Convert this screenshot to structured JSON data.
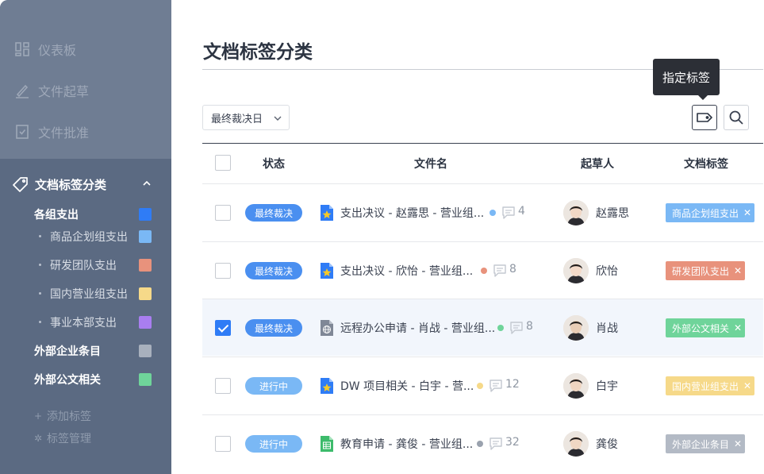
{
  "sidebar": {
    "nav": [
      {
        "label": "仪表板",
        "icon": "dashboard-icon"
      },
      {
        "label": "文件起草",
        "icon": "pen-icon"
      },
      {
        "label": "文件批准",
        "icon": "checkdoc-icon"
      }
    ],
    "section": {
      "label": "文档标签分类",
      "icon": "tag-icon"
    },
    "tags": [
      {
        "label": "各组支出",
        "level": "parent",
        "color": "#2f7cf6"
      },
      {
        "label": "商品企划组支出",
        "level": "child",
        "color": "#7ab8f5"
      },
      {
        "label": "研发团队支出",
        "level": "child",
        "color": "#e8927c"
      },
      {
        "label": "国内营业组支出",
        "level": "child",
        "color": "#f6d989"
      },
      {
        "label": "事业本部支出",
        "level": "child",
        "color": "#a97ef0"
      },
      {
        "label": "外部企业条目",
        "level": "parent",
        "color": "#a8b0bd"
      },
      {
        "label": "外部公文相关",
        "level": "parent",
        "color": "#6fd49a"
      }
    ],
    "add_tag": "添加标签",
    "manage_tags": "标签管理"
  },
  "main": {
    "title": "文档标签分类",
    "filter": {
      "selected": "最终裁决日"
    },
    "tooltip": "指定标签",
    "columns": {
      "status": "状态",
      "filename": "文件名",
      "author": "起草人",
      "tags": "文档标签"
    },
    "rows": [
      {
        "checked": false,
        "status": "最终裁决",
        "status_color": "#4a8ff0",
        "file_icon": "starred-doc-icon",
        "file": "支出决议 - 赵露思 - 营业组...",
        "dot_color": "#7ab8f5",
        "comments": "4",
        "author": "赵露思",
        "tag": "商品企划组支出",
        "tag_color": "#7ab8f5"
      },
      {
        "checked": false,
        "status": "最终裁决",
        "status_color": "#4a8ff0",
        "file_icon": "starred-doc-icon",
        "file": "支出决议 - 欣怡 - 营业组...",
        "dot_color": "#e8927c",
        "comments": "8",
        "author": "欣怡",
        "tag": "研发团队支出",
        "tag_color": "#e8927c"
      },
      {
        "checked": true,
        "status": "最终裁决",
        "status_color": "#4a8ff0",
        "file_icon": "globe-doc-icon",
        "file": "远程办公申请 - 肖战 - 营业组...",
        "dot_color": "#6fd49a",
        "comments": "8",
        "author": "肖战",
        "tag": "外部公文相关",
        "tag_color": "#6fd49a"
      },
      {
        "checked": false,
        "status": "进行中",
        "status_color": "#7ab8f5",
        "file_icon": "starred-doc-icon",
        "file": "DW 项目相关 - 白宇 - 营...",
        "dot_color": "#f6d989",
        "comments": "12",
        "author": "白宇",
        "tag": "国内营业组支出",
        "tag_color": "#f6d989"
      },
      {
        "checked": false,
        "status": "进行中",
        "status_color": "#7ab8f5",
        "file_icon": "sheet-doc-icon",
        "file": "教育申请 - 龚俊 - 营业组...",
        "dot_color": "#9aa2ae",
        "comments": "32",
        "author": "龚俊",
        "tag": "外部企业条目",
        "tag_color": "#b3bac5"
      }
    ]
  }
}
